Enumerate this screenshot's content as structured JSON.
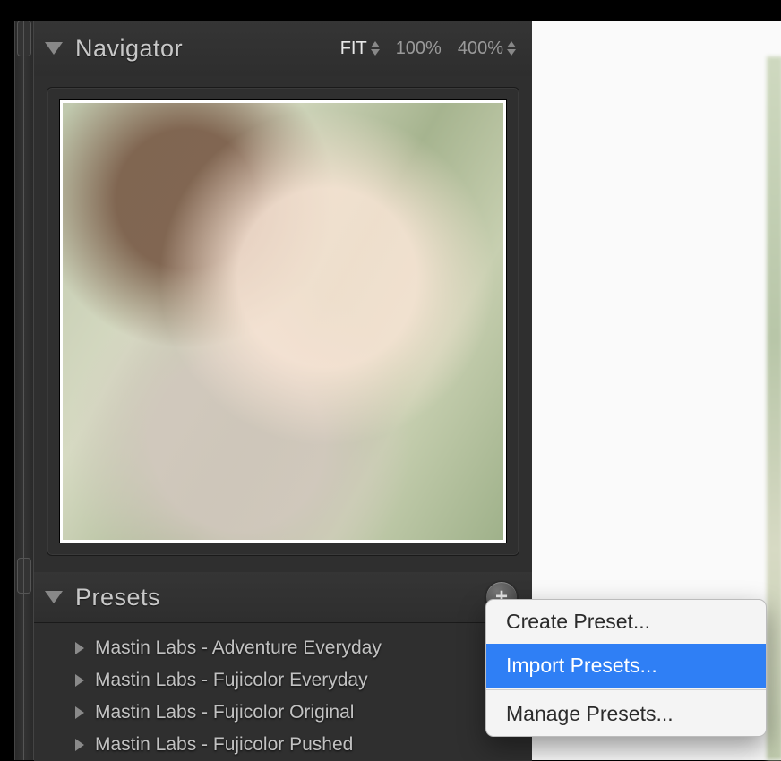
{
  "navigator": {
    "title": "Navigator",
    "zoom": {
      "fit": "FIT",
      "p100": "100%",
      "p400": "400%"
    }
  },
  "presets": {
    "title": "Presets",
    "add_glyph": "+",
    "items": [
      {
        "label": "Mastin Labs - Adventure Everyday"
      },
      {
        "label": "Mastin Labs - Fujicolor Everyday"
      },
      {
        "label": "Mastin Labs - Fujicolor Original"
      },
      {
        "label": "Mastin Labs - Fujicolor Pushed"
      }
    ]
  },
  "context_menu": {
    "create": "Create Preset...",
    "import": "Import Presets...",
    "manage": "Manage Presets..."
  }
}
